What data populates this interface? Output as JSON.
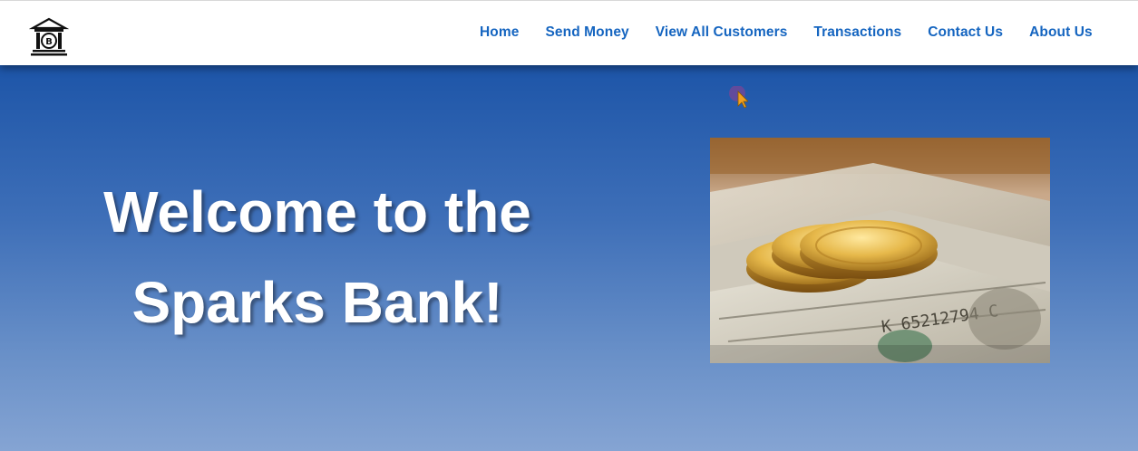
{
  "nav": {
    "logo_icon": "bank-building-icon",
    "links": [
      "Home",
      "Send Money",
      "View All Customers",
      "Transactions",
      "Contact Us",
      "About Us"
    ]
  },
  "hero": {
    "title_line1": "Welcome to the",
    "title_line2": "Sparks Bank!",
    "image_icon": "money-coins-image"
  },
  "colors": {
    "nav_link": "#1565c0",
    "hero_top": "#1d55a8",
    "hero_bottom": "#85a4d3"
  }
}
